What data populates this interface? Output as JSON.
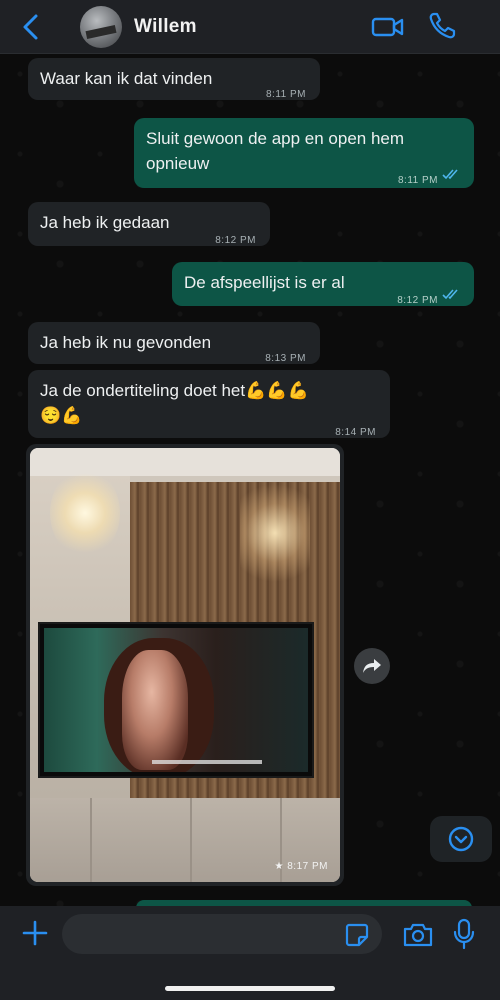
{
  "header": {
    "contact_name": "Willem",
    "icons": [
      "back-chevron-icon",
      "video-camera-icon",
      "phone-icon"
    ],
    "accent_color": "#2a8ff0"
  },
  "messages": [
    {
      "direction": "incoming",
      "text": "Waar kan ik dat vinden",
      "time": "8:11 PM"
    },
    {
      "direction": "outgoing",
      "text": "Sluit gewoon de app en open hem opnieuw",
      "time": "8:11 PM",
      "status": "read"
    },
    {
      "direction": "incoming",
      "text": "Ja heb ik gedaan",
      "time": "8:12 PM"
    },
    {
      "direction": "outgoing",
      "text": "De afspeellijst is er al",
      "time": "8:12 PM",
      "status": "read"
    },
    {
      "direction": "incoming",
      "text": "Ja heb ik nu gevonden",
      "time": "8:13 PM"
    },
    {
      "direction": "incoming",
      "text": "Ja de ondertiteling doet het",
      "emoji_line1": "💪💪💪",
      "emoji_line2": "😌💪",
      "time": "8:14 PM"
    },
    {
      "direction": "incoming",
      "type": "photo",
      "time": "8:17 PM",
      "starred": true
    }
  ],
  "composer": {
    "placeholder": "",
    "icons": [
      "plus-icon",
      "sticker-icon",
      "camera-icon",
      "microphone-icon"
    ]
  },
  "colors": {
    "incoming_bubble": "#202326",
    "outgoing_bubble": "#0d5546",
    "read_ticks": "#4fb6ec"
  }
}
